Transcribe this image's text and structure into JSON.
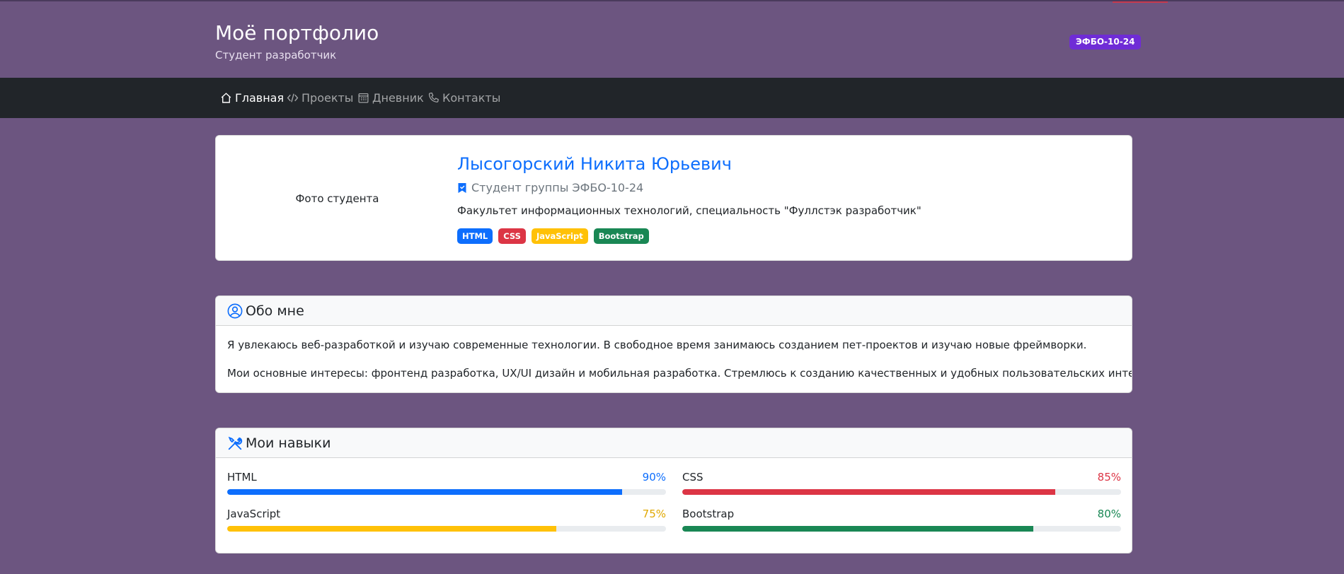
{
  "header": {
    "title": "Моё портфолио",
    "subtitle": "Студент разработчик",
    "group_badge": "ЭФБО-10-24"
  },
  "nav": {
    "items": [
      {
        "label": "Главная",
        "icon": "house-icon",
        "active": true
      },
      {
        "label": "Проекты",
        "icon": "code-icon",
        "active": false
      },
      {
        "label": "Дневник",
        "icon": "journal-icon",
        "active": false
      },
      {
        "label": "Контакты",
        "icon": "telephone-icon",
        "active": false
      }
    ]
  },
  "profile": {
    "photo_label": "Фото студента",
    "name": "Лысогорский Никита Юрьевич",
    "group_line": "Студент группы ЭФБО-10-24",
    "faculty": "Факультет информационных технологий, специальность \"Фуллстэк разработчик\"",
    "tags": [
      {
        "label": "HTML",
        "color": "#0d6efd"
      },
      {
        "label": "CSS",
        "color": "#dc3545"
      },
      {
        "label": "JavaScript",
        "color": "#ffc107"
      },
      {
        "label": "Bootstrap",
        "color": "#198754"
      }
    ]
  },
  "about": {
    "title": "Обо мне",
    "paragraphs": [
      "Я увлекаюсь веб-разработкой и изучаю современные технологии. В свободное время занимаюсь созданием пет-проектов и изучаю новые фреймворки.",
      "Мои основные интересы: фронтенд разработка, UX/UI дизайн и мобильная разработка. Стремлюсь к созданию качественных и удобных пользовательских интерфейсов."
    ]
  },
  "skills": {
    "title": "Мои навыки",
    "items": [
      {
        "name": "HTML",
        "percent_label": "90%",
        "level": 90,
        "color": "#0d6efd"
      },
      {
        "name": "CSS",
        "percent_label": "85%",
        "level": 85,
        "color": "#dc3545"
      },
      {
        "name": "JavaScript",
        "percent_label": "75%",
        "level": 75,
        "color": "#ffc107"
      },
      {
        "name": "Bootstrap",
        "percent_label": "80%",
        "level": 80,
        "color": "#198754"
      }
    ]
  },
  "colors": {
    "page_bg": "#6c5580",
    "navbar_bg": "#212529",
    "badge_bg": "#6f2cd6",
    "accent": "#0d6efd"
  }
}
